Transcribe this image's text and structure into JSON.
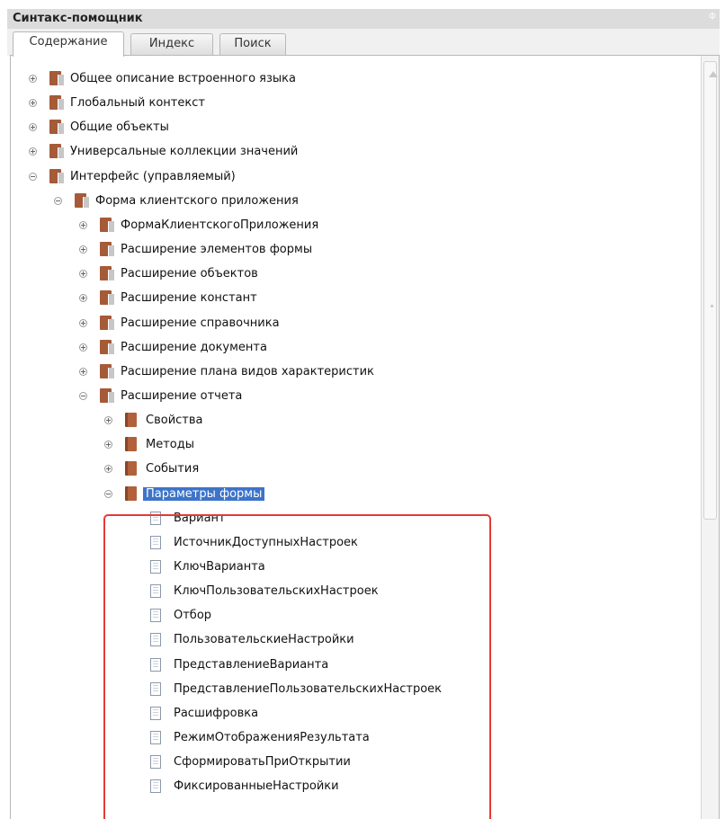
{
  "window": {
    "title": "Синтакс-помощник",
    "pin": "ф"
  },
  "tabs": [
    {
      "label": "Содержание",
      "active": true
    },
    {
      "label": "Индекс",
      "active": false
    },
    {
      "label": "Поиск",
      "active": false
    }
  ],
  "tree": [
    {
      "label": "Общее описание встроенного языка",
      "level": 0,
      "expander": "plus",
      "icon": "multi"
    },
    {
      "label": "Глобальный контекст",
      "level": 0,
      "expander": "plus",
      "icon": "multi"
    },
    {
      "label": "Общие объекты",
      "level": 0,
      "expander": "plus",
      "icon": "multi"
    },
    {
      "label": "Универсальные коллекции значений",
      "level": 0,
      "expander": "plus",
      "icon": "multi"
    },
    {
      "label": "Интерфейс (управляемый)",
      "level": 0,
      "expander": "minus",
      "icon": "multi"
    },
    {
      "label": "Форма клиентского приложения",
      "level": 1,
      "expander": "minus",
      "icon": "multi"
    },
    {
      "label": "ФормаКлиентскогоПриложения",
      "level": 2,
      "expander": "plus",
      "icon": "multi"
    },
    {
      "label": "Расширение элементов формы",
      "level": 2,
      "expander": "plus",
      "icon": "multi"
    },
    {
      "label": "Расширение объектов",
      "level": 2,
      "expander": "plus",
      "icon": "multi"
    },
    {
      "label": "Расширение констант",
      "level": 2,
      "expander": "plus",
      "icon": "multi"
    },
    {
      "label": "Расширение справочника",
      "level": 2,
      "expander": "plus",
      "icon": "multi"
    },
    {
      "label": "Расширение документа",
      "level": 2,
      "expander": "plus",
      "icon": "multi"
    },
    {
      "label": "Расширение плана видов характеристик",
      "level": 2,
      "expander": "plus",
      "icon": "multi"
    },
    {
      "label": "Расширение отчета",
      "level": 2,
      "expander": "minus",
      "icon": "multi"
    },
    {
      "label": "Свойства",
      "level": 3,
      "expander": "plus",
      "icon": "single"
    },
    {
      "label": "Методы",
      "level": 3,
      "expander": "plus",
      "icon": "single"
    },
    {
      "label": "События",
      "level": 3,
      "expander": "plus",
      "icon": "single"
    },
    {
      "label": "Параметры формы",
      "level": 3,
      "expander": "minus",
      "icon": "single",
      "selected": true
    },
    {
      "label": "Вариант",
      "level": 4,
      "expander": "none",
      "icon": "page"
    },
    {
      "label": "ИсточникДоступныхНастроек",
      "level": 4,
      "expander": "none",
      "icon": "page"
    },
    {
      "label": "КлючВарианта",
      "level": 4,
      "expander": "none",
      "icon": "page"
    },
    {
      "label": "КлючПользовательскихНастроек",
      "level": 4,
      "expander": "none",
      "icon": "page"
    },
    {
      "label": "Отбор",
      "level": 4,
      "expander": "none",
      "icon": "page"
    },
    {
      "label": "ПользовательскиеНастройки",
      "level": 4,
      "expander": "none",
      "icon": "page"
    },
    {
      "label": "ПредставлениеВарианта",
      "level": 4,
      "expander": "none",
      "icon": "page"
    },
    {
      "label": "ПредставлениеПользовательскихНастроек",
      "level": 4,
      "expander": "none",
      "icon": "page"
    },
    {
      "label": "Расшифровка",
      "level": 4,
      "expander": "none",
      "icon": "page"
    },
    {
      "label": "РежимОтображенияРезультата",
      "level": 4,
      "expander": "none",
      "icon": "page"
    },
    {
      "label": "СформироватьПриОткрытии",
      "level": 4,
      "expander": "none",
      "icon": "page"
    },
    {
      "label": "ФиксированныеНастройки",
      "level": 4,
      "expander": "none",
      "icon": "page"
    }
  ],
  "colors": {
    "selection": "#3d74c8",
    "highlight_border": "#e53935",
    "book": "#a55a38"
  }
}
